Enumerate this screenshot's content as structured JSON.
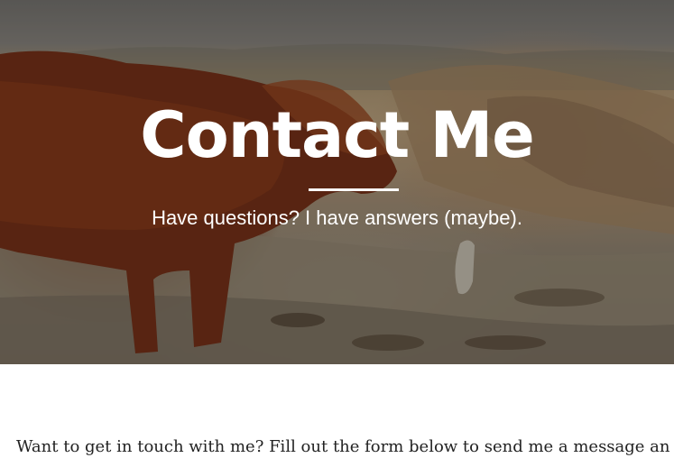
{
  "header": {
    "title": "Contact Me",
    "subtitle": "Have questions? I have answers (maybe)."
  },
  "content": {
    "intro": "Want to get in touch with me? Fill out the form below to send me a message an"
  },
  "colors": {
    "hero_text": "#ffffff",
    "body_text": "#222222",
    "background": "#ffffff"
  }
}
